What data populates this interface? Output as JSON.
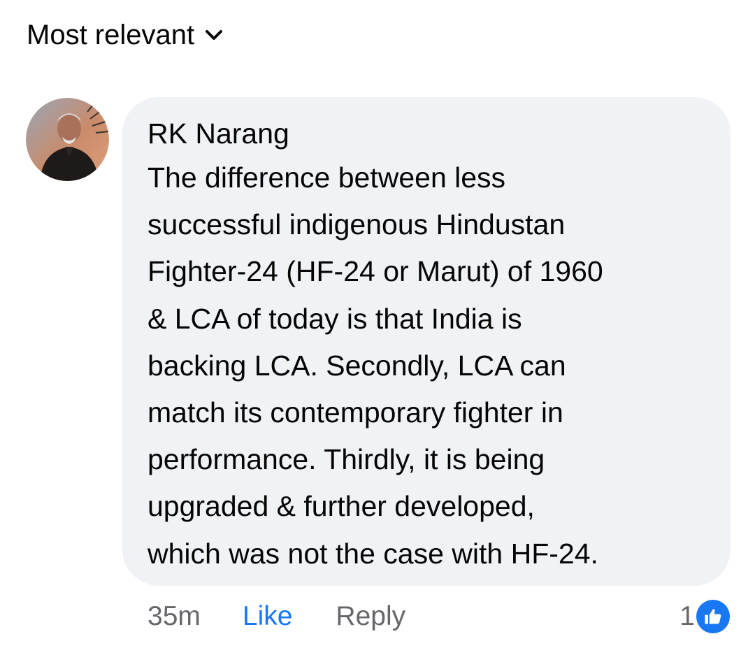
{
  "sort": {
    "label": "Most relevant",
    "icon": "chevron-down-icon"
  },
  "comment": {
    "author": "RK Narang",
    "text": "The difference between less\nsuccessful indigenous Hindustan\nFighter-24 (HF-24 or Marut) of 1960\n& LCA of today is that India is\nbacking LCA. Secondly, LCA can\nmatch its contemporary fighter in\nperformance. Thirdly, it is being\nupgraded & further developed,\nwhich was not the case with HF-24.",
    "time": "35m",
    "like_label": "Like",
    "reply_label": "Reply",
    "reaction_count": "1",
    "reaction_icon": "thumbs-up-icon"
  },
  "colors": {
    "bubble_bg": "#f0f2f5",
    "accent": "#1877f2",
    "secondary_text": "#65676b",
    "primary_text": "#050505"
  }
}
